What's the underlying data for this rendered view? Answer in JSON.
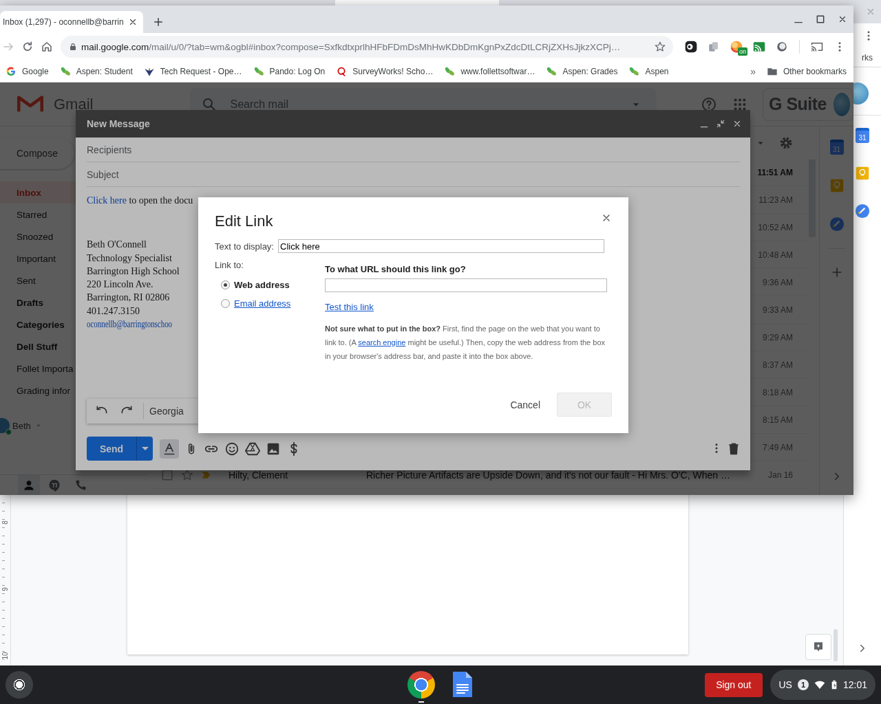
{
  "background_window": {
    "bookmark_fragment": "rks",
    "calendar_day": "31",
    "ruler_numbers": [
      "8",
      "9",
      "10"
    ]
  },
  "browser": {
    "tab": {
      "title": "Inbox (1,297) - oconnellb@barrin",
      "selected": true
    },
    "back_disabled": true,
    "url_host": "mail.google.com",
    "url_path": "/mail/u/0/?tab=wm&ogbl#inbox?compose=SxfkdtxprlhHFbFDmDsMhHwKDbDmKgnPxZdcDtLCRjZXHsJjkzXCPj…",
    "extension_badge": "on",
    "bookmarks": [
      {
        "label": "Google",
        "kind": "google"
      },
      {
        "label": "Aspen: Student",
        "kind": "leaf"
      },
      {
        "label": "Tech Request - Ope…",
        "kind": "eagle"
      },
      {
        "label": "Pando: Log On",
        "kind": "leaf"
      },
      {
        "label": "SurveyWorks! Scho…",
        "kind": "q"
      },
      {
        "label": "www.follettsoftwar…",
        "kind": "leaf"
      },
      {
        "label": "Aspen: Grades",
        "kind": "leaf"
      },
      {
        "label": "Aspen",
        "kind": "leaf"
      }
    ],
    "bookmarks_overflow": "»",
    "other_bookmarks": "Other bookmarks"
  },
  "gmail": {
    "logo_text": "Gmail",
    "search_placeholder": "Search mail",
    "gsuite": "G Suite",
    "compose_button": "Compose",
    "nav": [
      {
        "label": "Inbox",
        "selected": true,
        "unread": true
      },
      {
        "label": "Starred",
        "selected": false,
        "unread": false
      },
      {
        "label": "Snoozed",
        "selected": false,
        "unread": false
      },
      {
        "label": "Important",
        "selected": false,
        "unread": false
      },
      {
        "label": "Sent",
        "selected": false,
        "unread": false
      },
      {
        "label": "Drafts",
        "selected": false,
        "unread": true
      },
      {
        "label": "Categories",
        "selected": false,
        "unread": true
      },
      {
        "label": "Dell Stuff",
        "selected": false,
        "unread": true
      },
      {
        "label": "Follet Importa",
        "selected": false,
        "unread": false
      },
      {
        "label": "Grading infor",
        "selected": false,
        "unread": false
      }
    ],
    "account": "Beth",
    "message_times": [
      {
        "time": "11:51 AM",
        "unread": true
      },
      {
        "time": "11:23 AM",
        "unread": false
      },
      {
        "time": "10:52 AM",
        "unread": false
      },
      {
        "time": "10:48 AM",
        "unread": false
      },
      {
        "time": "9:36 AM",
        "unread": false
      },
      {
        "time": "9:33 AM",
        "unread": false
      },
      {
        "time": "9:29 AM",
        "unread": false
      },
      {
        "time": "8:37 AM",
        "unread": false
      },
      {
        "time": "8:18 AM",
        "unread": false
      },
      {
        "time": "8:15 AM",
        "unread": false
      },
      {
        "time": "7:49 AM",
        "unread": false
      }
    ],
    "last_message": {
      "sender": "Hilty, Clement",
      "subject": "Richer Picture Artifacts are Upside Down, and it's not our fault - Hi Mrs. O'C, When …",
      "time": "Jan 16"
    },
    "calendar_day": "31"
  },
  "compose": {
    "title": "New Message",
    "recipients_placeholder": "Recipients",
    "subject_placeholder": "Subject",
    "body_link": "Click here ",
    "body_text": "to open the docu",
    "signature": [
      "Beth O'Connell",
      "Technology Specialist",
      "Barrington High School",
      "220 Lincoln Ave.",
      "Barrington, RI 02806",
      "401.247.3150"
    ],
    "signature_email": "oconnellb@barringtonschoo",
    "formatting_open": true,
    "font_name": "Georgia",
    "send": "Send"
  },
  "dialog": {
    "title": "Edit Link",
    "display_label": "Text to display:",
    "display_value": "Click here",
    "link_to_label": "Link to:",
    "link_types": [
      {
        "label": "Web address",
        "selected": true
      },
      {
        "label": "Email address",
        "selected": false
      }
    ],
    "url_prompt": "To what URL should this link go?",
    "test_link": "Test this link",
    "help_before": "**Not sure what to put in the box?** First, find the page on the web that you want to link to. (A ",
    "help_link": "search engine",
    "help_after": " might be useful.) Then, copy the web address from the box in your browser's address bar, and paste it into the box above.",
    "cancel": "Cancel",
    "ok": {
      "label": "OK",
      "disabled": true
    }
  },
  "shelf": {
    "sign_out": "Sign out",
    "ime": "US",
    "notification_count": "1",
    "time": "12:01"
  }
}
